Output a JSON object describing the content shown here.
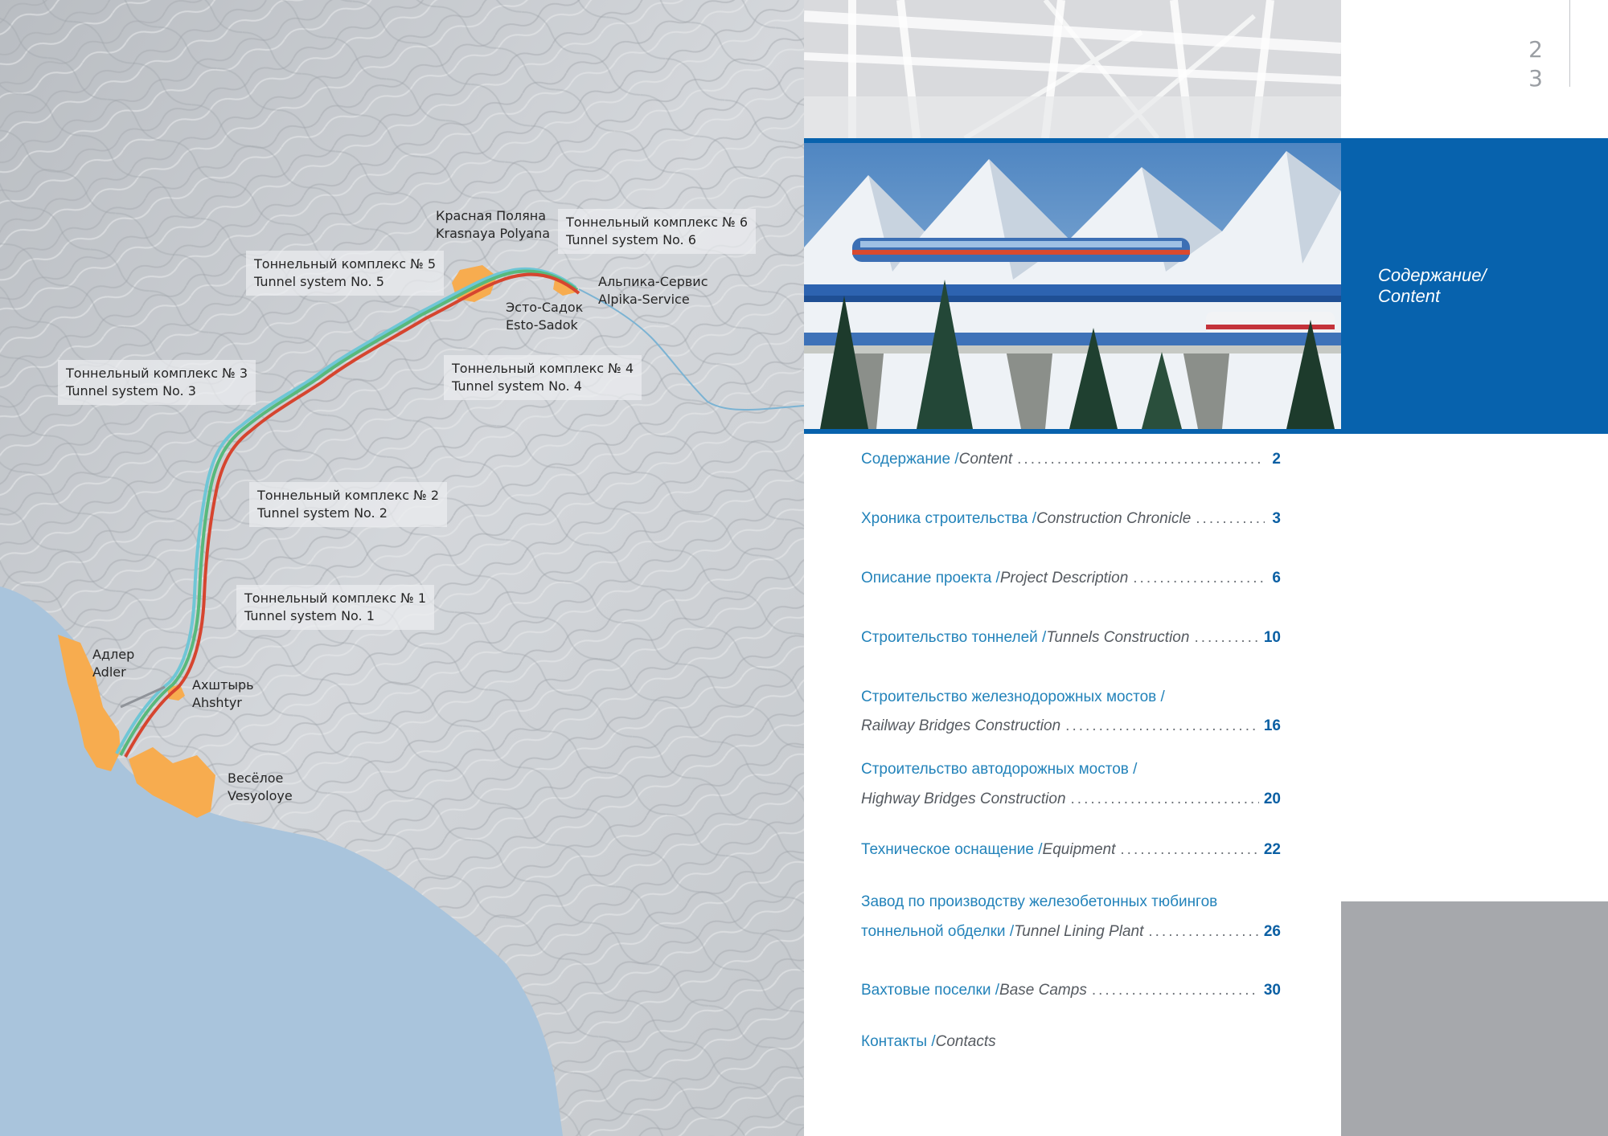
{
  "map": {
    "labels": [
      {
        "id": "tunnel-6",
        "ru": "Тоннельный комплекс № 6",
        "en": "Tunnel system No. 6"
      },
      {
        "id": "tunnel-5",
        "ru": "Тоннельный комплекс № 5",
        "en": "Tunnel system No. 5"
      },
      {
        "id": "tunnel-4",
        "ru": "Тоннельный комплекс № 4",
        "en": "Tunnel system No. 4"
      },
      {
        "id": "tunnel-3",
        "ru": "Тоннельный комплекс № 3",
        "en": "Tunnel system No. 3"
      },
      {
        "id": "tunnel-2",
        "ru": "Тоннельный комплекс № 2",
        "en": "Tunnel system No. 2"
      },
      {
        "id": "tunnel-1",
        "ru": "Тоннельный комплекс № 1",
        "en": "Tunnel system No. 1"
      }
    ],
    "places": [
      {
        "id": "krasnaya-polyana",
        "ru": "Красная Поляна",
        "en": "Krasnaya Polyana"
      },
      {
        "id": "alpika-service",
        "ru": "Альпика-Сервис",
        "en": "Alpika-Service"
      },
      {
        "id": "esto-sadok",
        "ru": "Эсто-Садок",
        "en": "Esto-Sadok"
      },
      {
        "id": "adler",
        "ru": "Адлер",
        "en": "Adler"
      },
      {
        "id": "ahshtyr",
        "ru": "Ахштырь",
        "en": "Ahshtyr"
      },
      {
        "id": "vesyoloye",
        "ru": "Весёлое",
        "en": "Vesyoloye"
      }
    ],
    "colors": {
      "sea": "#a9c4dc",
      "settlement": "#f7ac4f",
      "route_red": "#d6452f",
      "route_green": "#58b97c",
      "route_cyan": "#6fc6d6",
      "river": "#7bb3d3"
    }
  },
  "page_numbers": {
    "left": "2",
    "right": "3"
  },
  "section_title": {
    "line1": "Содержание/",
    "line2": "Content"
  },
  "colors": {
    "accent_blue": "#0762ad",
    "toc_text": "#2383ba",
    "gray_block": "#a6a8ac"
  },
  "toc": [
    {
      "ru": "Содержание / ",
      "en": "Content",
      "page": "2"
    },
    {
      "ru": "Хроника строительства / ",
      "en": "Construction Chronicle",
      "page": "3"
    },
    {
      "ru": "Описание проекта / ",
      "en": "Project Description",
      "page": "6"
    },
    {
      "ru": "Строительство тоннелей / ",
      "en": "Tunnels Construction",
      "page": "10"
    },
    {
      "ru": "Строительство железнодорожных мостов /",
      "en": "Railway Bridges Construction",
      "page": "16"
    },
    {
      "ru": "Строительство автодорожных мостов /",
      "en": "Highway Bridges Construction",
      "page": "20"
    },
    {
      "ru": "Техническое оснащение / ",
      "en": "Equipment",
      "page": "22"
    },
    {
      "ru": "Завод по производству железобетонных тюбингов",
      "ru2": "тоннельной обделки / ",
      "en": "Tunnel Lining Plant",
      "page": "26"
    },
    {
      "ru": "Вахтовые поселки / ",
      "en": "Base Camps",
      "page": "30"
    },
    {
      "ru": "Контакты / ",
      "en": "Contacts",
      "page": ""
    }
  ]
}
